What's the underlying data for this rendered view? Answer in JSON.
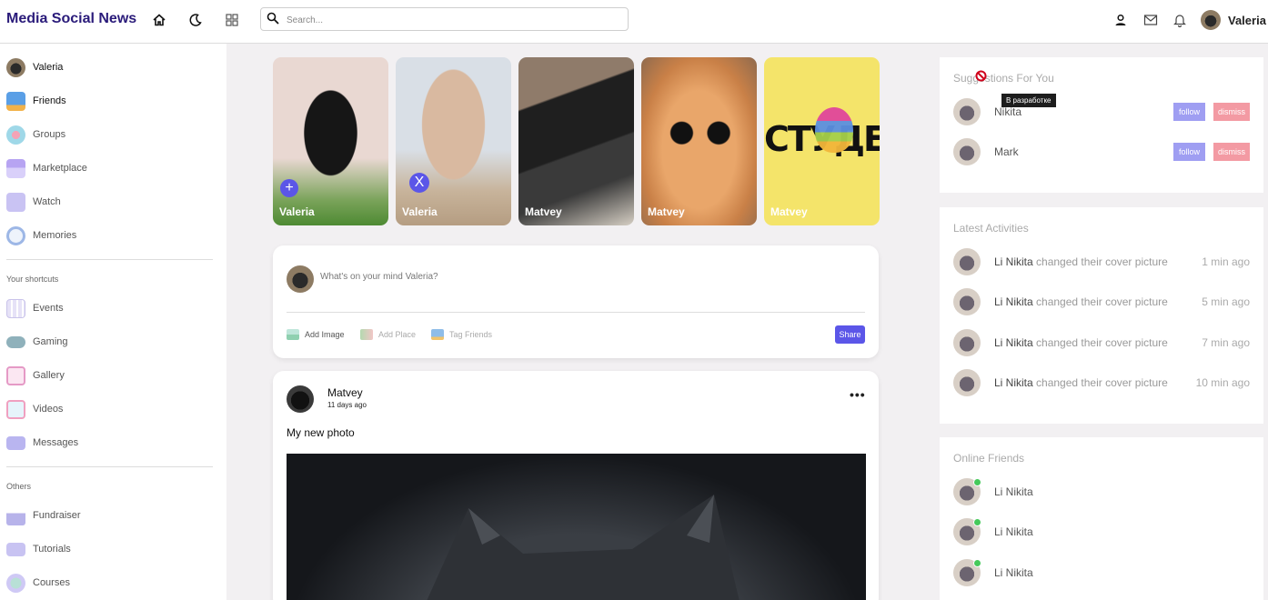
{
  "app": {
    "title": "Media Social News"
  },
  "navbar": {
    "search_placeholder": "Search...",
    "user_name": "Valeria"
  },
  "sidebar": {
    "items": [
      {
        "label": "Valeria",
        "icon": "user-avatar"
      },
      {
        "label": "Friends",
        "icon": "friends-icon"
      },
      {
        "label": "Groups",
        "icon": "groups-icon"
      },
      {
        "label": "Marketplace",
        "icon": "marketplace-icon"
      },
      {
        "label": "Watch",
        "icon": "watch-icon"
      },
      {
        "label": "Memories",
        "icon": "memories-icon"
      }
    ],
    "shortcuts_title": "Your shortcuts",
    "shortcuts": [
      {
        "label": "Events",
        "icon": "events-icon"
      },
      {
        "label": "Gaming",
        "icon": "gaming-icon"
      },
      {
        "label": "Gallery",
        "icon": "gallery-icon"
      },
      {
        "label": "Videos",
        "icon": "videos-icon"
      },
      {
        "label": "Messages",
        "icon": "messages-icon"
      }
    ],
    "others_title": "Others",
    "others": [
      {
        "label": "Fundraiser",
        "icon": "fundraiser-icon"
      },
      {
        "label": "Tutorials",
        "icon": "tutorials-icon"
      },
      {
        "label": "Courses",
        "icon": "courses-icon"
      }
    ]
  },
  "stories": [
    {
      "name": "Valeria",
      "button": "+"
    },
    {
      "name": "Valeria",
      "button": "X"
    },
    {
      "name": "Matvey"
    },
    {
      "name": "Matvey"
    },
    {
      "name": "Matvey",
      "banner_text": "СТУДЕ"
    }
  ],
  "create_post": {
    "placeholder": "What's on your mind Valeria?",
    "add_image": "Add Image",
    "add_place": "Add Place",
    "tag_friends": "Tag Friends",
    "share": "Share"
  },
  "post": {
    "author": "Matvey",
    "time": "11 days ago",
    "text": "My new photo",
    "more": "•••"
  },
  "suggestions": {
    "title": "Suggestions For You",
    "tooltip": "В разработке",
    "people": [
      {
        "name": "Nikita",
        "follow": "follow",
        "dismiss": "dismiss"
      },
      {
        "name": "Mark",
        "follow": "follow",
        "dismiss": "dismiss"
      }
    ]
  },
  "activities": {
    "title": "Latest Activities",
    "items": [
      {
        "name": "Li Nikita",
        "action": "changed their cover picture",
        "time": "1 min ago"
      },
      {
        "name": "Li Nikita",
        "action": "changed their cover picture",
        "time": "5 min ago"
      },
      {
        "name": "Li Nikita",
        "action": "changed their cover picture",
        "time": "7 min ago"
      },
      {
        "name": "Li Nikita",
        "action": "changed their cover picture",
        "time": "10 min ago"
      }
    ]
  },
  "online": {
    "title": "Online Friends",
    "friends": [
      {
        "name": "Li Nikita"
      },
      {
        "name": "Li Nikita"
      },
      {
        "name": "Li Nikita"
      }
    ]
  },
  "colors": {
    "brand": "#2a1b7a",
    "accent": "#5b56e8",
    "follow": "#9f9ef2",
    "dismiss": "#f39aa3",
    "online": "#45c95a"
  }
}
